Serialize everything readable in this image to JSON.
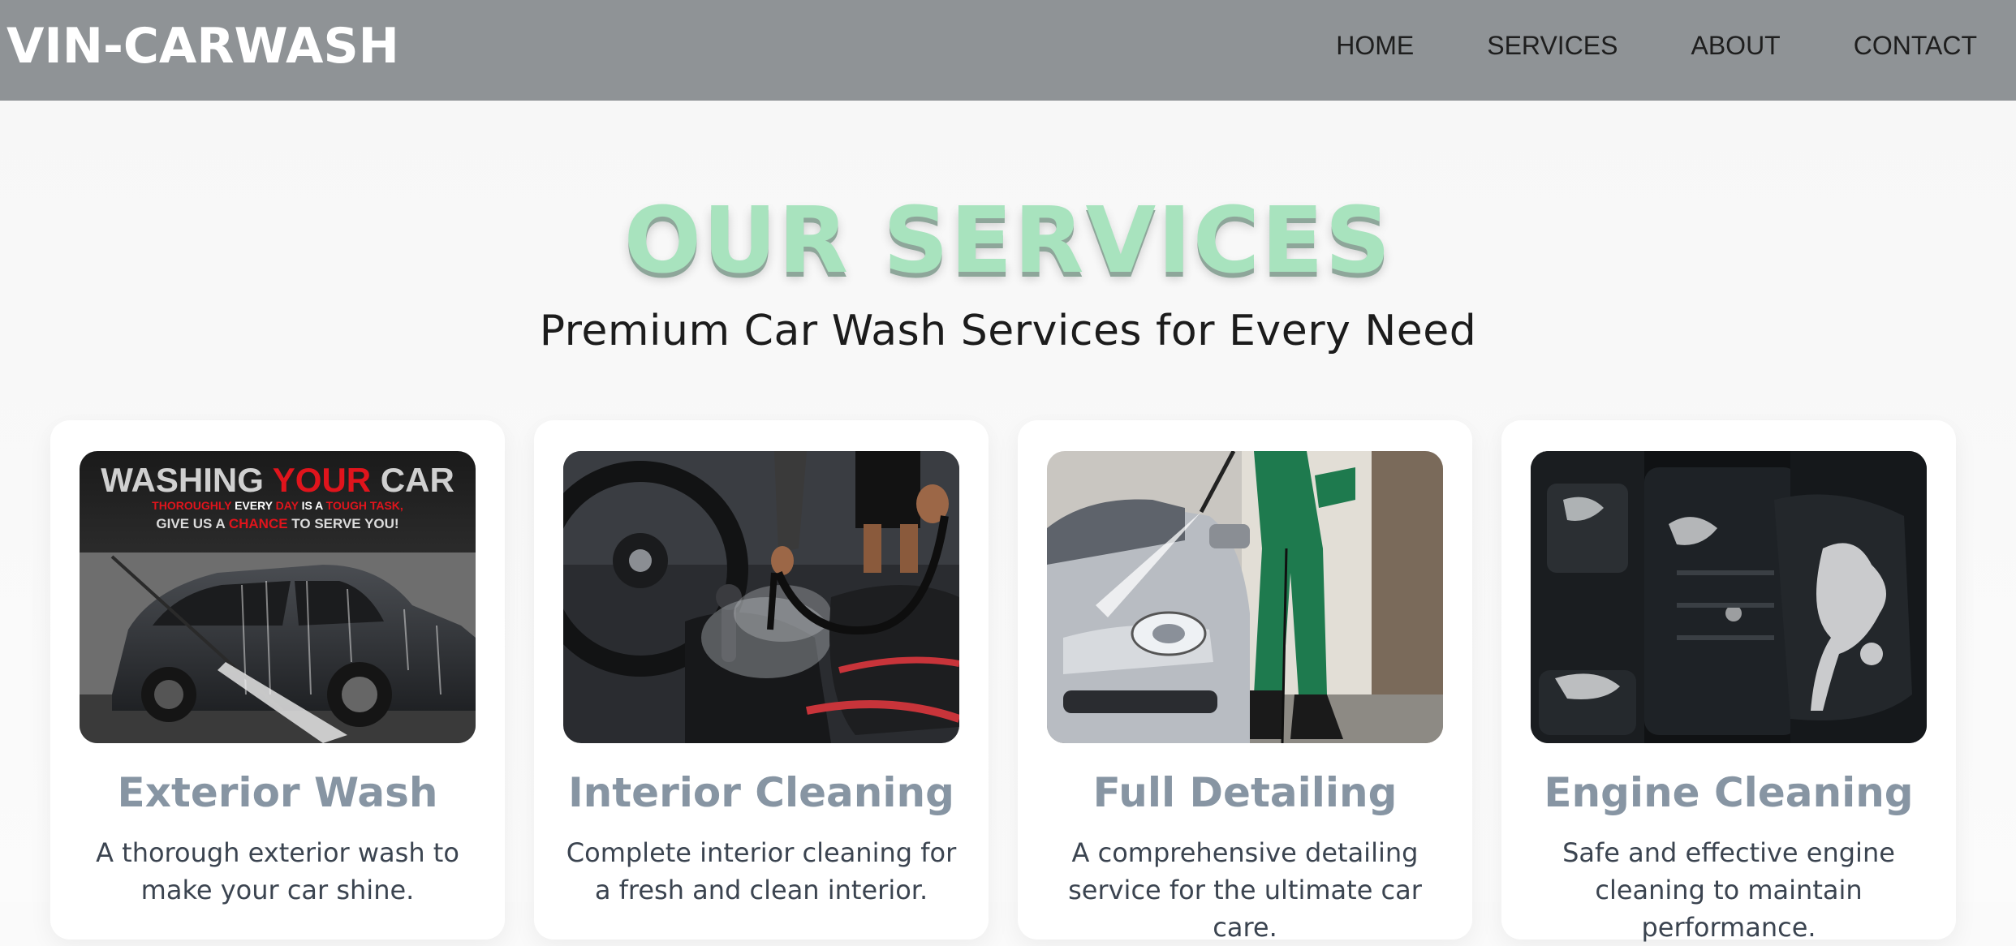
{
  "brand": "VIN-CARWASH",
  "nav": {
    "items": [
      "HOME",
      "SERVICES",
      "ABOUT",
      "CONTACT"
    ]
  },
  "section": {
    "title": "OUR SERVICES",
    "subtitle": "Premium Car Wash Services for Every Need"
  },
  "cards": [
    {
      "title": "Exterior Wash",
      "description": "A thorough exterior wash to make your car shine.",
      "image": {
        "headline_1": "WASHING ",
        "headline_2": "YOUR",
        "headline_3": " CAR",
        "line2_a": "THOROUGHLY",
        "line2_b": " EVERY ",
        "line2_c": "DAY",
        "line2_d": " IS A ",
        "line2_e": "TOUGH TASK,",
        "line3_a": "GIVE US A ",
        "line3_b": "CHANCE",
        "line3_c": " TO SERVE YOU!"
      }
    },
    {
      "title": "Interior Cleaning",
      "description": "Complete interior cleaning for a fresh and clean interior."
    },
    {
      "title": "Full Detailing",
      "description": "A comprehensive detailing service for the ultimate car care."
    },
    {
      "title": "Engine Cleaning",
      "description": "Safe and effective engine cleaning to maintain performance."
    }
  ],
  "colors": {
    "navbar": "#8f9396",
    "heading": "#a8e3be",
    "card_title": "#8795a3",
    "accent_red": "#e0141c"
  }
}
